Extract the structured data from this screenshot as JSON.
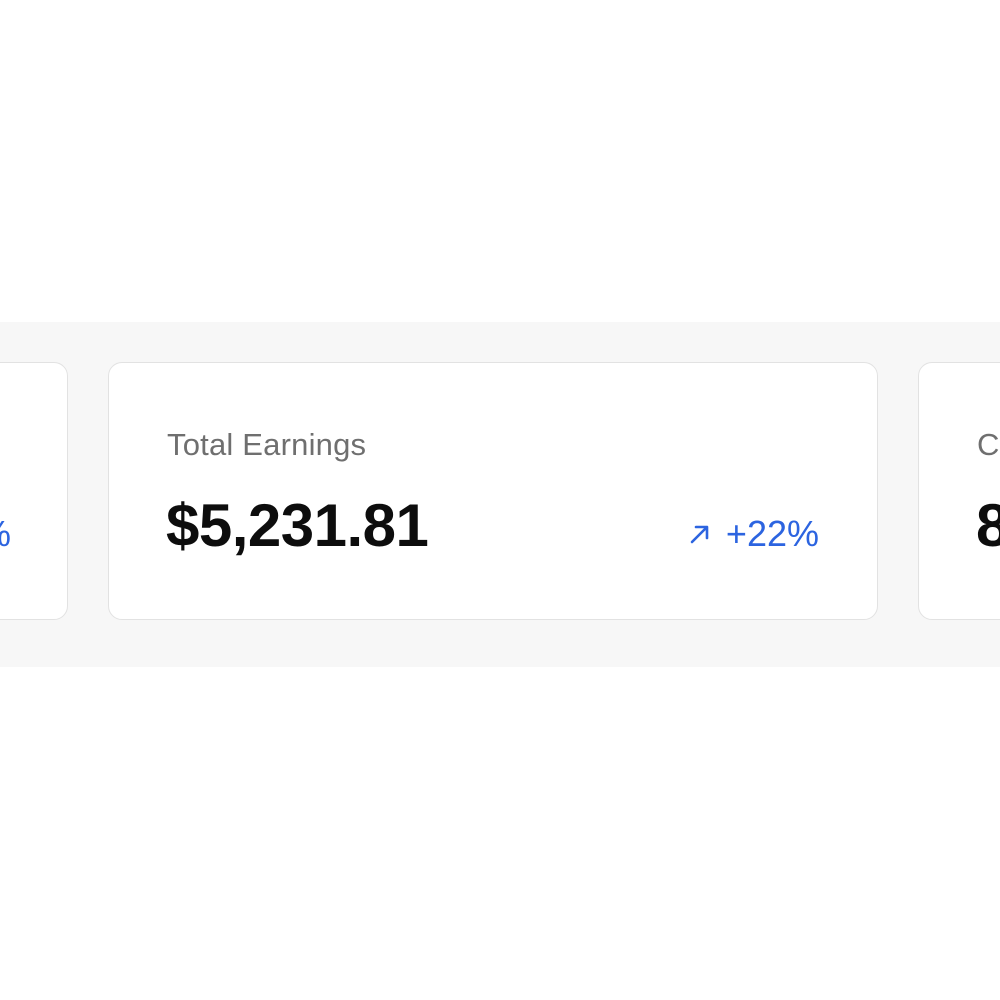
{
  "cards": {
    "left": {
      "change": "%"
    },
    "main": {
      "label": "Total Earnings",
      "value": "$5,231.81",
      "change": "+22%",
      "change_icon": "arrow-up-right-icon"
    },
    "right": {
      "label": "C",
      "value": "8"
    }
  },
  "colors": {
    "band_background": "#f7f7f7",
    "card_background": "#ffffff",
    "card_border": "#e2e2e2",
    "label": "#6f6f6f",
    "value": "#0d0d0d",
    "positive_change": "#2c64e0"
  }
}
